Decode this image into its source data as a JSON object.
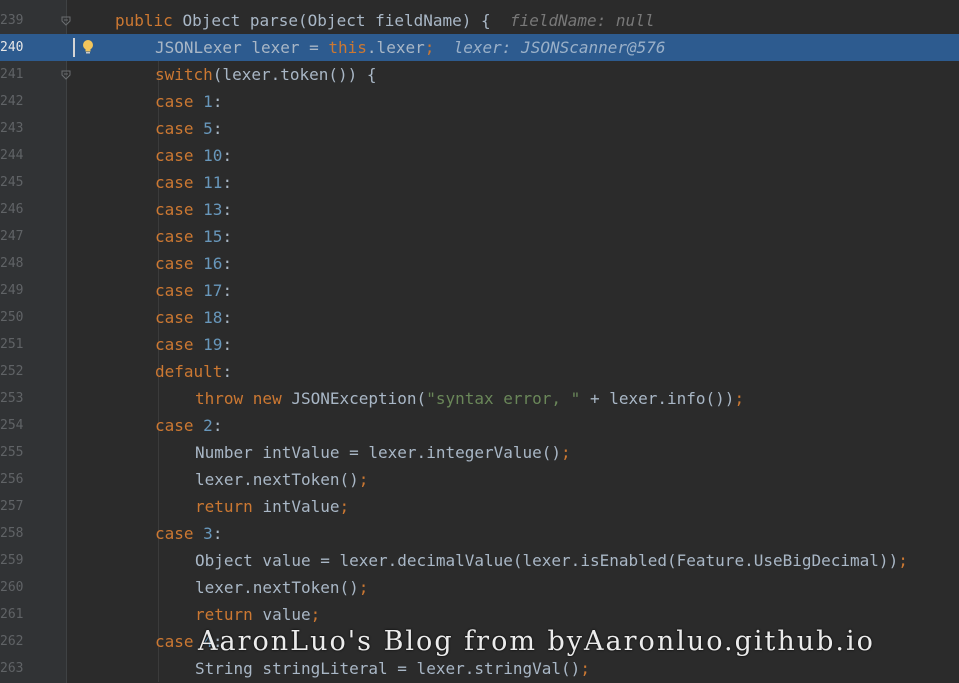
{
  "lines": [
    {
      "num": "239",
      "indent": 1,
      "highlight": false,
      "fold": "open",
      "tokens": [
        {
          "t": "public ",
          "c": "k"
        },
        {
          "t": "Object parse(Object fieldName) { ",
          "c": "p"
        },
        {
          "t": " fieldName: null",
          "c": "hint"
        }
      ]
    },
    {
      "num": "240",
      "indent": 2,
      "highlight": true,
      "breakpoint": true,
      "bulb": true,
      "tokens": [
        {
          "t": "JSONLexer lexer = ",
          "c": "p"
        },
        {
          "t": "this",
          "c": "k"
        },
        {
          "t": ".lexer",
          "c": "p"
        },
        {
          "t": ";",
          "c": "k"
        },
        {
          "t": "  lexer: JSONScanner@576",
          "c": "hint"
        }
      ]
    },
    {
      "num": "241",
      "indent": 2,
      "highlight": false,
      "fold": "open",
      "tokens": [
        {
          "t": "switch",
          "c": "k"
        },
        {
          "t": "(lexer.token()) {",
          "c": "p"
        }
      ]
    },
    {
      "num": "242",
      "indent": 2,
      "tokens": [
        {
          "t": "case ",
          "c": "k"
        },
        {
          "t": "1",
          "c": "n"
        },
        {
          "t": ":",
          "c": "p"
        }
      ]
    },
    {
      "num": "243",
      "indent": 2,
      "tokens": [
        {
          "t": "case ",
          "c": "k"
        },
        {
          "t": "5",
          "c": "n"
        },
        {
          "t": ":",
          "c": "p"
        }
      ]
    },
    {
      "num": "244",
      "indent": 2,
      "tokens": [
        {
          "t": "case ",
          "c": "k"
        },
        {
          "t": "10",
          "c": "n"
        },
        {
          "t": ":",
          "c": "p"
        }
      ]
    },
    {
      "num": "245",
      "indent": 2,
      "tokens": [
        {
          "t": "case ",
          "c": "k"
        },
        {
          "t": "11",
          "c": "n"
        },
        {
          "t": ":",
          "c": "p"
        }
      ]
    },
    {
      "num": "246",
      "indent": 2,
      "tokens": [
        {
          "t": "case ",
          "c": "k"
        },
        {
          "t": "13",
          "c": "n"
        },
        {
          "t": ":",
          "c": "p"
        }
      ]
    },
    {
      "num": "247",
      "indent": 2,
      "tokens": [
        {
          "t": "case ",
          "c": "k"
        },
        {
          "t": "15",
          "c": "n"
        },
        {
          "t": ":",
          "c": "p"
        }
      ]
    },
    {
      "num": "248",
      "indent": 2,
      "tokens": [
        {
          "t": "case ",
          "c": "k"
        },
        {
          "t": "16",
          "c": "n"
        },
        {
          "t": ":",
          "c": "p"
        }
      ]
    },
    {
      "num": "249",
      "indent": 2,
      "tokens": [
        {
          "t": "case ",
          "c": "k"
        },
        {
          "t": "17",
          "c": "n"
        },
        {
          "t": ":",
          "c": "p"
        }
      ]
    },
    {
      "num": "250",
      "indent": 2,
      "tokens": [
        {
          "t": "case ",
          "c": "k"
        },
        {
          "t": "18",
          "c": "n"
        },
        {
          "t": ":",
          "c": "p"
        }
      ]
    },
    {
      "num": "251",
      "indent": 2,
      "tokens": [
        {
          "t": "case ",
          "c": "k"
        },
        {
          "t": "19",
          "c": "n"
        },
        {
          "t": ":",
          "c": "p"
        }
      ]
    },
    {
      "num": "252",
      "indent": 2,
      "tokens": [
        {
          "t": "default",
          "c": "k"
        },
        {
          "t": ":",
          "c": "p"
        }
      ]
    },
    {
      "num": "253",
      "indent": 3,
      "tokens": [
        {
          "t": "throw new ",
          "c": "k"
        },
        {
          "t": "JSONException(",
          "c": "p"
        },
        {
          "t": "\"syntax error, \"",
          "c": "s"
        },
        {
          "t": " + lexer.info())",
          "c": "p"
        },
        {
          "t": ";",
          "c": "k"
        }
      ]
    },
    {
      "num": "254",
      "indent": 2,
      "tokens": [
        {
          "t": "case ",
          "c": "k"
        },
        {
          "t": "2",
          "c": "n"
        },
        {
          "t": ":",
          "c": "p"
        }
      ]
    },
    {
      "num": "255",
      "indent": 3,
      "tokens": [
        {
          "t": "Number intValue = lexer.integerValue()",
          "c": "p"
        },
        {
          "t": ";",
          "c": "k"
        }
      ]
    },
    {
      "num": "256",
      "indent": 3,
      "tokens": [
        {
          "t": "lexer.nextToken()",
          "c": "p"
        },
        {
          "t": ";",
          "c": "k"
        }
      ]
    },
    {
      "num": "257",
      "indent": 3,
      "tokens": [
        {
          "t": "return ",
          "c": "k"
        },
        {
          "t": "intValue",
          "c": "p"
        },
        {
          "t": ";",
          "c": "k"
        }
      ]
    },
    {
      "num": "258",
      "indent": 2,
      "tokens": [
        {
          "t": "case ",
          "c": "k"
        },
        {
          "t": "3",
          "c": "n"
        },
        {
          "t": ":",
          "c": "p"
        }
      ]
    },
    {
      "num": "259",
      "indent": 3,
      "tokens": [
        {
          "t": "Object value = lexer.decimalValue(lexer.isEnabled(Feature.UseBigDecimal))",
          "c": "p"
        },
        {
          "t": ";",
          "c": "k"
        }
      ]
    },
    {
      "num": "260",
      "indent": 3,
      "tokens": [
        {
          "t": "lexer.nextToken()",
          "c": "p"
        },
        {
          "t": ";",
          "c": "k"
        }
      ]
    },
    {
      "num": "261",
      "indent": 3,
      "tokens": [
        {
          "t": "return ",
          "c": "k"
        },
        {
          "t": "value",
          "c": "p"
        },
        {
          "t": ";",
          "c": "k"
        }
      ]
    },
    {
      "num": "262",
      "indent": 2,
      "tokens": [
        {
          "t": "case ",
          "c": "k"
        },
        {
          "t": "4",
          "c": "n"
        },
        {
          "t": ":",
          "c": "p"
        }
      ]
    },
    {
      "num": "263",
      "indent": 3,
      "tokens": [
        {
          "t": "String stringLiteral = lexer.stringVal()",
          "c": "p"
        },
        {
          "t": ";",
          "c": "k"
        }
      ]
    }
  ],
  "watermark": "AaronLuo's Blog from byAaronluo.github.io",
  "colors": {
    "keyword": "#cc7832",
    "number": "#6897bb",
    "string": "#6a8759",
    "text": "#a9b7c6",
    "highlight": "#2d5b8f",
    "background": "#2b2b2b"
  },
  "icons": {
    "bulb": "lightbulb-icon",
    "fold": "fold-marker-icon"
  }
}
